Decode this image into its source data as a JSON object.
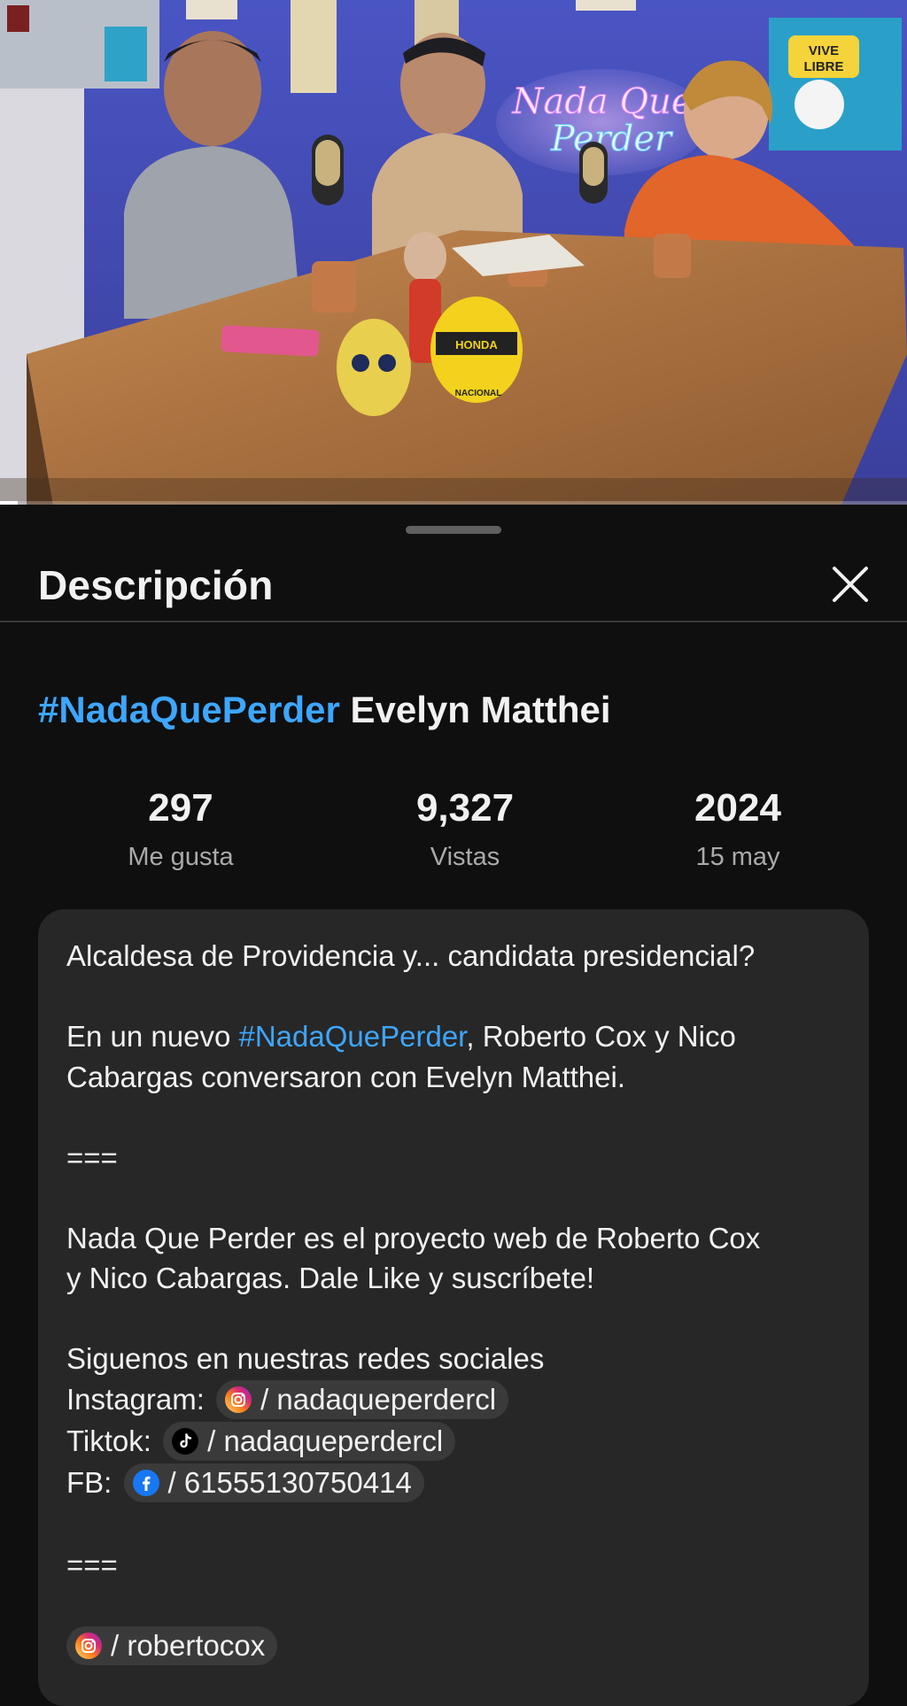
{
  "video": {
    "neon_sign": [
      "Nada Que",
      "Perder"
    ],
    "wall_poster_text": [
      "VIVE",
      "LIBRE"
    ],
    "helmet_brand": "HONDA",
    "helmet_sponsor": "NACIONAL"
  },
  "sheet": {
    "title": "Descripción"
  },
  "video_title": {
    "hashtag": "#NadaQuePerder",
    "name": "Evelyn Matthei"
  },
  "stats": [
    {
      "value": "297",
      "label": "Me gusta"
    },
    {
      "value": "9,327",
      "label": "Vistas"
    },
    {
      "value": "2024",
      "label": "15 may"
    }
  ],
  "description": {
    "line1": "Alcaldesa de Providencia y... candidata presidencial?",
    "para2_prefix": "En un nuevo ",
    "para2_hashtag": "#NadaQuePerder",
    "para2_line1_rest": ", Roberto Cox y Nico",
    "para2_line2": "Cabargas conversaron con Evelyn Matthei.",
    "separator": "===",
    "para3_line1": "Nada Que Perder es el proyecto web de Roberto Cox",
    "para3_line2": "y Nico Cabargas. Dale Like y suscríbete!",
    "follow_line": "Siguenos en nuestras redes sociales",
    "instagram_label": "Instagram: ",
    "instagram_handle": "/ nadaqueperdercl",
    "tiktok_label": "Tiktok: ",
    "tiktok_handle": "/ nadaqueperdercl",
    "fb_label": "FB: ",
    "fb_handle": "/ 61555130750414",
    "separator2": "===",
    "host_instagram": "/ robertocox"
  },
  "colors": {
    "link": "#3ea6ff",
    "instagram": "#e1306c",
    "facebook": "#1877f2"
  }
}
